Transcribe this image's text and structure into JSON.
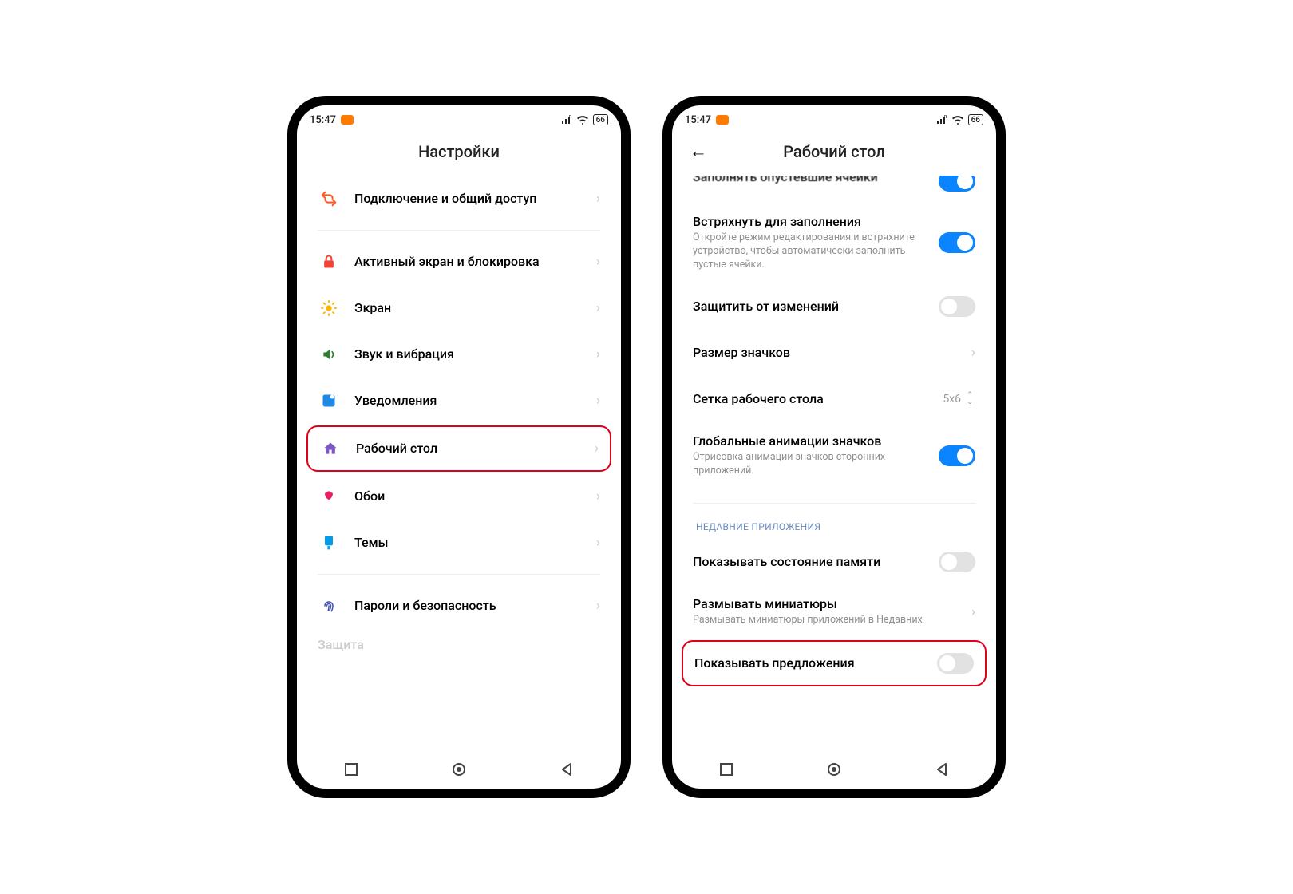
{
  "status": {
    "time": "15:47",
    "battery": "66"
  },
  "left": {
    "title": "Настройки",
    "items": [
      {
        "label": "Подключение и общий доступ",
        "icon": "share",
        "color": "#ff5722"
      },
      {
        "label": "Активный экран и блокировка",
        "icon": "lock",
        "color": "#f44336"
      },
      {
        "label": "Экран",
        "icon": "sun",
        "color": "#ffb300"
      },
      {
        "label": "Звук и вибрация",
        "icon": "sound",
        "color": "#2e7d32"
      },
      {
        "label": "Уведомления",
        "icon": "notif",
        "color": "#1e88e5"
      },
      {
        "label": "Рабочий стол",
        "icon": "home",
        "color": "#7e57c2",
        "highlight": true
      },
      {
        "label": "Обои",
        "icon": "wallpaper",
        "color": "#e91e63"
      },
      {
        "label": "Темы",
        "icon": "theme",
        "color": "#039be5"
      },
      {
        "label": "Пароли и безопасность",
        "icon": "finger",
        "color": "#3f51b5"
      }
    ],
    "partial": "Защита"
  },
  "right": {
    "title": "Рабочий стол",
    "cut_title": "Заполнять опустевшие ячейки",
    "rows": [
      {
        "title": "Встряхнуть для заполнения",
        "sub": "Откройте режим редактирования и встряхните устройство, чтобы автоматически заполнить пустые ячейки.",
        "type": "toggle",
        "on": true
      },
      {
        "title": "Защитить от изменений",
        "type": "toggle",
        "on": false
      },
      {
        "title": "Размер значков",
        "type": "chev"
      },
      {
        "title": "Сетка рабочего стола",
        "type": "value",
        "value": "5x6"
      },
      {
        "title": "Глобальные анимации значков",
        "sub": "Отрисовка анимации значков сторонних приложений.",
        "type": "toggle",
        "on": true
      }
    ],
    "section": "НЕДАВНИЕ ПРИЛОЖЕНИЯ",
    "rows2": [
      {
        "title": "Показывать состояние памяти",
        "type": "toggle",
        "on": false
      },
      {
        "title": "Размывать миниатюры",
        "sub": "Размывать миниатюры приложений в Недавних",
        "type": "chev"
      },
      {
        "title": "Показывать предложения",
        "type": "toggle",
        "on": false,
        "highlight": true
      }
    ]
  }
}
